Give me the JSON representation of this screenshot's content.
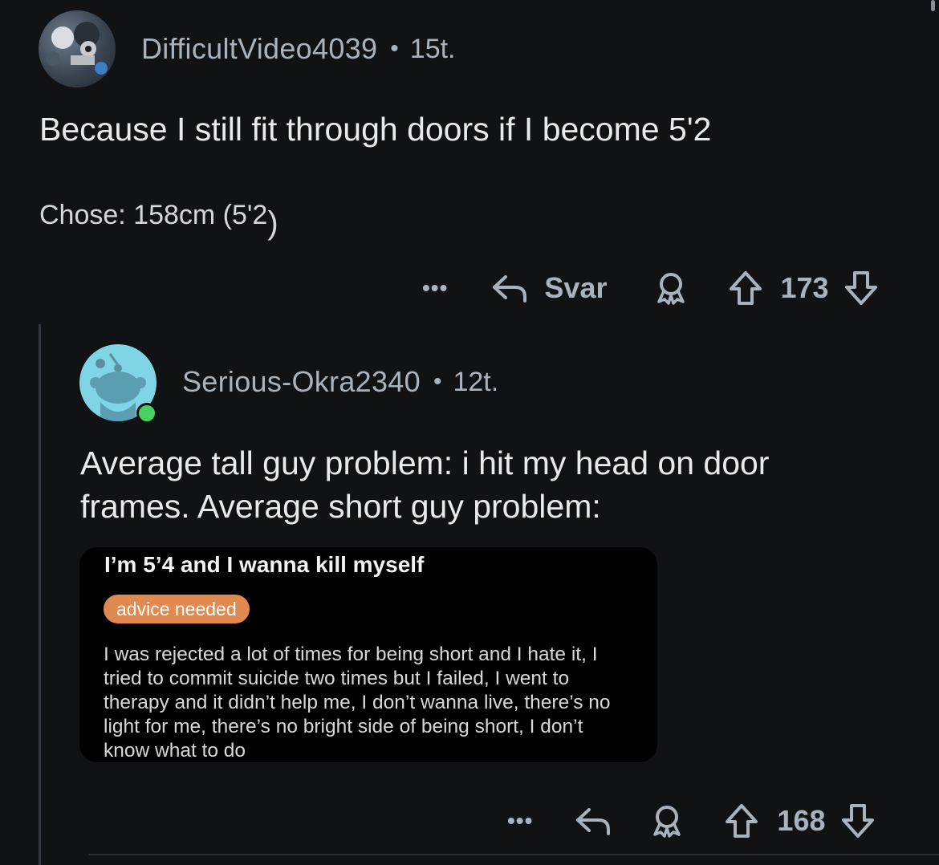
{
  "comment1": {
    "username": "DifficultVideo4039",
    "separator": "•",
    "time": "15t.",
    "body": "Because I still fit through doors if I become 5'2",
    "chose_label": "Chose: 158cm (5'2",
    "chose_suffix": ")",
    "actions": {
      "more": "•••",
      "reply_label": "Svar",
      "score": "173"
    }
  },
  "comment2": {
    "username": "Serious-Okra2340",
    "separator": "•",
    "time": "12t.",
    "body_line1": "Average tall guy problem: i hit my head on door",
    "body_line2": "frames. Average short guy problem:",
    "embedded_post": {
      "title": "I’m 5’4 and I wanna kill myself",
      "flair": "advice needed",
      "lines": [
        "I was rejected a lot of times for being short and I hate it, I",
        "tried to commit suicide two times but I failed, I went to",
        "therapy and it didn’t help me, I don’t wanna live, there’s no",
        "light for me, there’s no bright side of being short, I don’t",
        "know what to do"
      ]
    },
    "actions": {
      "more": "•••",
      "score": "168"
    }
  },
  "colors": {
    "background": "#111214",
    "meta": "#a8b3bd",
    "flair": "#e08a4f",
    "online": "#46d160"
  }
}
